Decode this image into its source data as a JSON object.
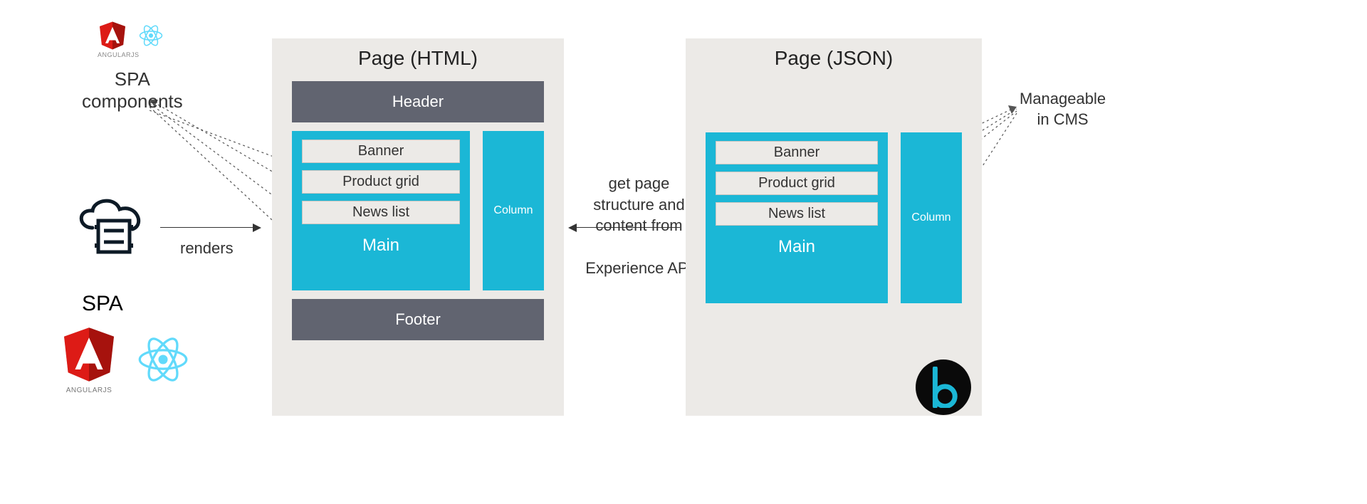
{
  "left": {
    "spa_components": "SPA\ncomponents",
    "spa": "SPA",
    "renders": "renders"
  },
  "pageHtml": {
    "title": "Page (HTML)",
    "header": "Header",
    "footer": "Footer",
    "main": "Main",
    "column": "Column",
    "items": [
      "Banner",
      "Product grid",
      "News list"
    ]
  },
  "middle": {
    "line1": "get page",
    "line2": "structure and",
    "line3": "content from",
    "line4": "Experience API"
  },
  "pageJson": {
    "title": "Page (JSON)",
    "main": "Main",
    "column": "Column",
    "items": [
      "Banner",
      "Product grid",
      "News list"
    ]
  },
  "right": {
    "cms": "Manageable\nin CMS"
  },
  "icons": {
    "angular_label": "ANGULARJS"
  }
}
